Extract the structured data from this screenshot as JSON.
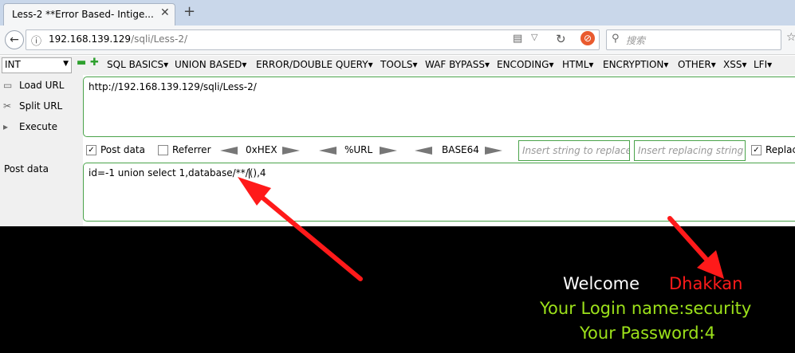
{
  "tab": {
    "title": "Less-2 **Error Based- Intige...",
    "close": "✕",
    "new": "+"
  },
  "nav": {
    "url_host": "192.168.139.129",
    "url_path": "/sqli/Less-2/",
    "search_placeholder": "搜索"
  },
  "hackbar": {
    "select_value": "INT",
    "minus": "▬",
    "plus": "✚",
    "menus": [
      "SQL BASICS▾",
      "UNION BASED▾",
      "ERROR/DOUBLE QUERY▾",
      "TOOLS▾",
      "WAF BYPASS▾",
      "ENCODING▾",
      "HTML▾",
      "ENCRYPTION▾",
      "OTHER▾",
      "XSS▾",
      "LFI▾"
    ],
    "load_url": "Load URL",
    "split_url": "Split URL",
    "execute": "Execute",
    "url_value": "http://192.168.139.129/sqli/Less-2/",
    "post_data_label": "Post data",
    "referrer_label": "Referrer",
    "hex_label": "0xHEX",
    "url_enc_label": "%URL",
    "base64_label": "BASE64",
    "insert_string_placeholder": "Insert string to replace",
    "insert_replacing_placeholder": "Insert replacing string",
    "replace_all_label": "Replac",
    "post_data_side_label": "Post data",
    "post_value_before": "id=-1 union select 1,database/**/",
    "post_value_after": "(),4"
  },
  "page": {
    "welcome": "Welcome",
    "name": "Dhakkan",
    "login_line": "Your Login name:security",
    "password_line": "Your Password:4"
  },
  "colors": {
    "accent_green": "#4aa34a",
    "page_bg": "#000000",
    "name_red": "#ff1a1a",
    "info_green": "#9ce11a",
    "arrow_red": "#ff1a1a"
  }
}
